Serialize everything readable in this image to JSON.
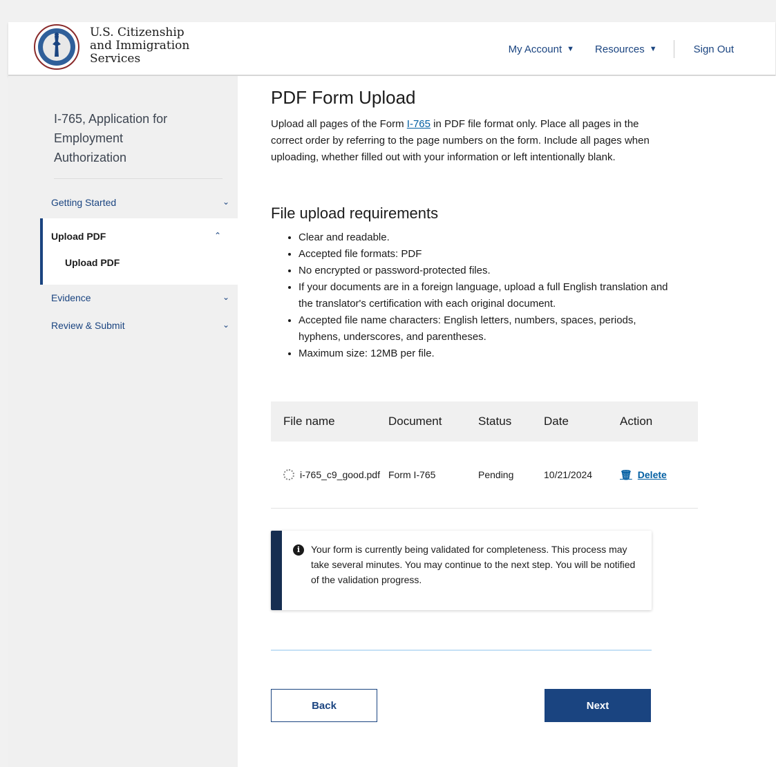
{
  "header": {
    "org_name_line1": "U.S. Citizenship",
    "org_name_line2": "and Immigration",
    "org_name_line3": "Services",
    "nav": {
      "my_account": "My Account",
      "resources": "Resources",
      "sign_out": "Sign Out"
    }
  },
  "sidebar": {
    "title": "I-765, Application for Employment Authorization",
    "items": [
      {
        "label": "Getting Started",
        "expanded": false
      },
      {
        "label": "Upload PDF",
        "expanded": true,
        "sub": "Upload PDF"
      },
      {
        "label": "Evidence",
        "expanded": false
      },
      {
        "label": "Review & Submit",
        "expanded": false
      }
    ]
  },
  "main": {
    "title": "PDF Form Upload",
    "intro_before": "Upload all pages of the Form ",
    "intro_link": "I-765",
    "intro_after": " in PDF file format only. Place all pages in the correct order by referring to the page numbers on the form. Include all pages when uploading, whether filled out with your information or left intentionally blank.",
    "requirements_title": "File upload requirements",
    "requirements": [
      "Clear and readable.",
      "Accepted file formats: PDF",
      "No encrypted or password-protected files.",
      "If your documents are in a foreign language, upload a full English translation and the translator's certification with each original document.",
      "Accepted file name characters: English letters, numbers, spaces, periods, hyphens, underscores, and parentheses.",
      "Maximum size: 12MB per file."
    ],
    "table": {
      "headers": [
        "File name",
        "Document",
        "Status",
        "Date",
        "Action"
      ],
      "rows": [
        {
          "file_name": "i-765_c9_good.pdf",
          "document": "Form I-765",
          "status": "Pending",
          "date": "10/21/2024",
          "action": "Delete"
        }
      ]
    },
    "alert": "Your form is currently being validated for completeness. This process may take several minutes. You may continue to the next step. You will be notified of the validation progress.",
    "buttons": {
      "back": "Back",
      "next": "Next"
    }
  },
  "colors": {
    "primary": "#1a4480",
    "link": "#005ea2",
    "alert_border": "#162e51"
  }
}
